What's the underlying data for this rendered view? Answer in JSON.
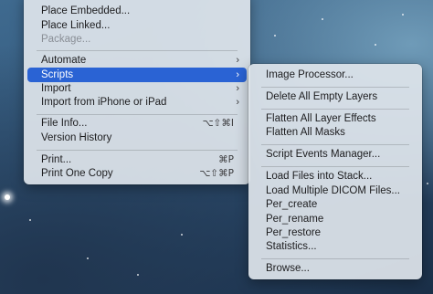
{
  "main_menu": {
    "items": [
      {
        "label": "Place Embedded..."
      },
      {
        "label": "Place Linked..."
      },
      {
        "label": "Package..."
      },
      {
        "label": "Automate"
      },
      {
        "label": "Scripts"
      },
      {
        "label": "Import"
      },
      {
        "label": "Import from iPhone or iPad"
      },
      {
        "label": "File Info...",
        "shortcut": "⌥⇧⌘I"
      },
      {
        "label": "Version History"
      },
      {
        "label": "Print...",
        "shortcut": "⌘P"
      },
      {
        "label": "Print One Copy",
        "shortcut": "⌥⇧⌘P"
      }
    ],
    "submenu_chevron": "›"
  },
  "scripts_submenu": {
    "items": [
      {
        "label": "Image Processor..."
      },
      {
        "label": "Delete All Empty Layers"
      },
      {
        "label": "Flatten All Layer Effects"
      },
      {
        "label": "Flatten All Masks"
      },
      {
        "label": "Script Events Manager..."
      },
      {
        "label": "Load Files into Stack..."
      },
      {
        "label": "Load Multiple DICOM Files..."
      },
      {
        "label": "Per_create"
      },
      {
        "label": "Per_rename"
      },
      {
        "label": "Per_restore"
      },
      {
        "label": "Statistics..."
      },
      {
        "label": "Browse..."
      }
    ]
  },
  "colors": {
    "highlight": "#2a63d4",
    "menu_background": "#dee4eb",
    "disabled_text": "#8a8f96"
  }
}
